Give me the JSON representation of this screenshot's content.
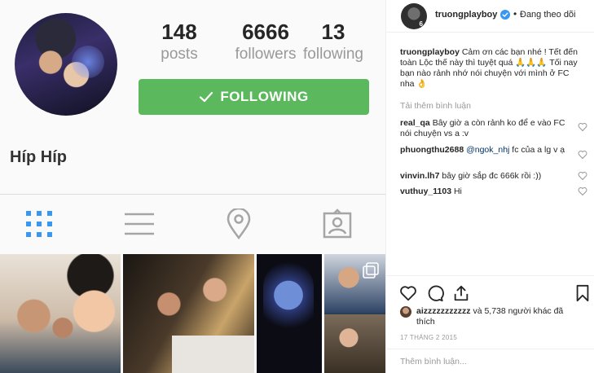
{
  "profile": {
    "name": "Híp Híp",
    "stats": [
      {
        "value": "148",
        "label": "posts"
      },
      {
        "value": "6666",
        "label": "followers"
      },
      {
        "value": "13",
        "label": "following"
      }
    ],
    "follow_button_label": "FOLLOWING",
    "tabs": [
      "grid-icon",
      "list-icon",
      "map-pin-icon",
      "tagged-icon"
    ],
    "accent_color": "#5cb85c"
  },
  "post": {
    "username": "truongplayboy",
    "header_separator": "•",
    "follow_status": "Đang theo dõi",
    "caption_username": "truongplayboy",
    "caption_text": "Cảm ơn các bạn nhé ! Tết đến toàn Lộc thế này thì tuyệt quá 🙏🙏🙏 Tối nay bạn nào rảnh nhớ nói chuyện với mình ở FC nha 👌",
    "load_more": "Tải thêm bình luận",
    "comments": [
      {
        "user": "real_qa",
        "text": "Bây giờ a còn rảnh ko để e vào FC nói chuyện vs a :v"
      },
      {
        "user": "phuongthu2688",
        "mention": "@ngok_nhj",
        "text": "fc của a lg v ạ"
      },
      {
        "user": "vinvin.lh7",
        "text": "bây giờ sắp đc 666k rồi :))"
      },
      {
        "user": "vuthuy_1103",
        "text": "Hi"
      }
    ],
    "likes": {
      "first_user": "aizzzzzzzzzzz",
      "rest": "và 5,738 người khác đã thích"
    },
    "date": "17 THÁNG 2 2015",
    "comment_placeholder": "Thêm bình luận..."
  }
}
